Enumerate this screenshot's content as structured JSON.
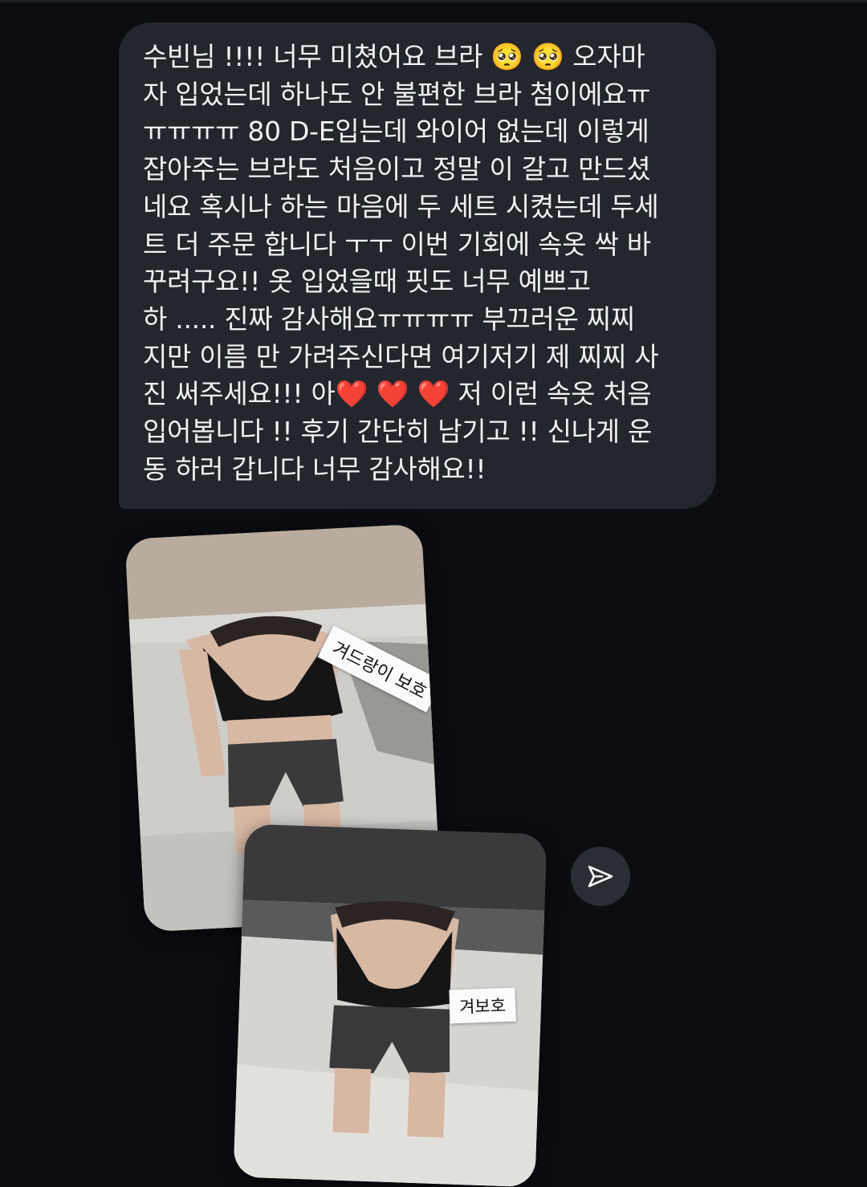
{
  "message": {
    "text": "수빈님 !!!! 너무 미쳤어요 브라 🥺 🥺 오자마\n자 입었는데 하나도 안 불편한 브라 첨이에요ㅠ\nㅠㅠㅠㅠ 80 D-E입는데 와이어 없는데 이렇게\n잡아주는 브라도 처음이고 정말 이 갈고 만드셨\n네요 혹시나 하는 마음에 두 세트 시켰는데 두세\n트 더 주문 합니다 ㅜㅜ 이번 기회에 속옷 싹 바\n꾸려구요!! 옷 입었을때 핏도 너무 예쁘고\n하 ..... 진짜 감사해요ㅠㅠㅠㅠ 부끄러운 찌찌\n지만 이름 만 가려주신다면 여기저기 제 찌찌 사\n진 써주세요!!! 아❤️ ❤️ ❤️  저 이런 속옷 처음\n입어봅니다 !! 후기 간단히 남기고 !! 신나게 운\n동 하러 갑니다 너무 감사해요!!"
  },
  "photos": [
    {
      "sticker_label": "겨드랑이 보호"
    },
    {
      "sticker_label": "겨보호"
    }
  ],
  "share_button": {
    "icon": "paper-plane-icon"
  },
  "colors": {
    "background": "#0b0d12",
    "bubble": "#23262d",
    "text": "#f2f2f4",
    "share_button": "#2a2d33"
  }
}
